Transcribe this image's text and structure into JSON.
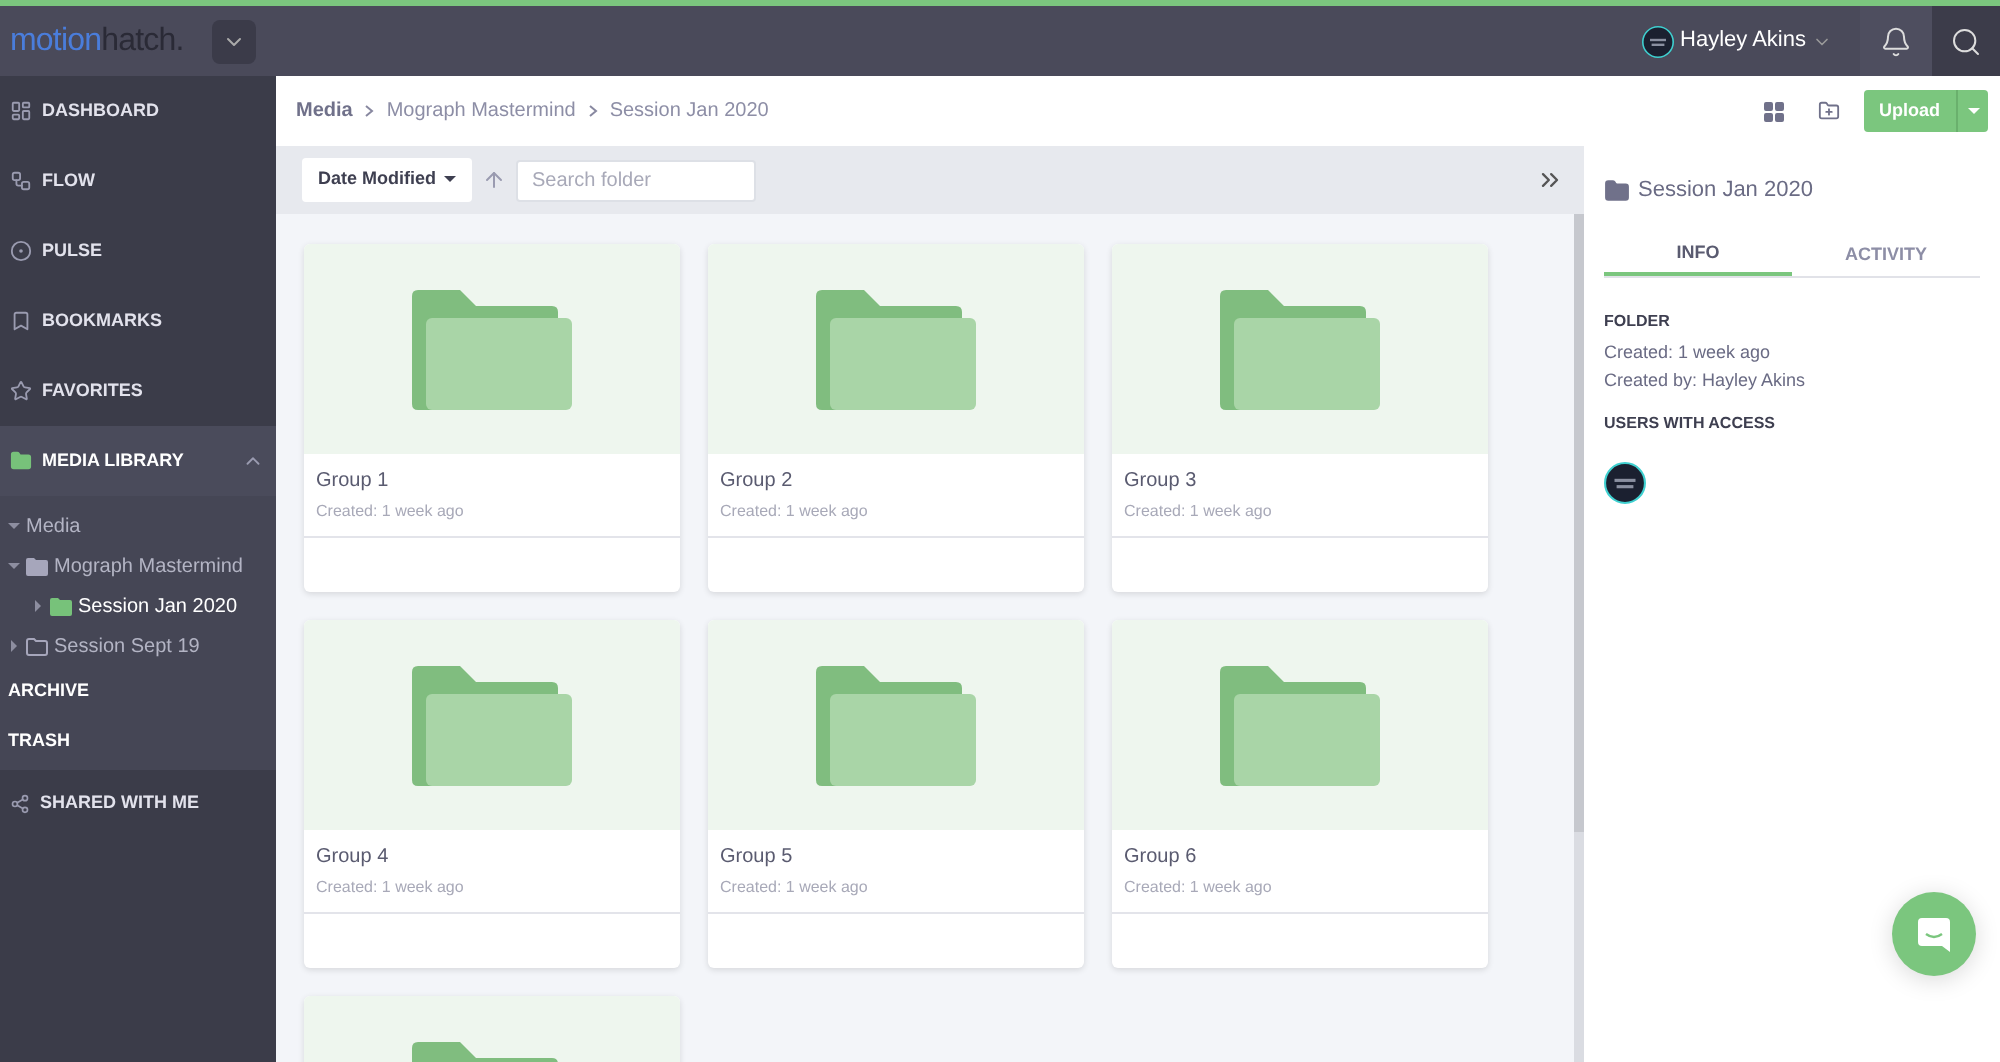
{
  "brand": {
    "part1": "motion",
    "part2": "hatch."
  },
  "user": {
    "name": "Hayley Akins"
  },
  "nav": [
    {
      "label": "DASHBOARD",
      "selected": false
    },
    {
      "label": "FLOW",
      "selected": false
    },
    {
      "label": "PULSE",
      "selected": false
    },
    {
      "label": "BOOKMARKS",
      "selected": false
    },
    {
      "label": "FAVORITES",
      "selected": false
    }
  ],
  "media_library": {
    "label": "MEDIA LIBRARY",
    "expanded": true,
    "selected": true,
    "tree": [
      {
        "label": "Media",
        "expanded": true,
        "selected": false,
        "children": [
          {
            "label": "Mograph Mastermind",
            "expanded": true,
            "selected": false,
            "children": [
              {
                "label": "Session Jan 2020",
                "expanded": false,
                "selected": true
              }
            ]
          },
          {
            "label": "Session Sept 19",
            "expanded": false,
            "selected": false
          }
        ]
      }
    ]
  },
  "nav_bottom": [
    {
      "label": "ARCHIVE"
    },
    {
      "label": "TRASH"
    }
  ],
  "shared": {
    "label": "SHARED WITH ME"
  },
  "breadcrumbs": [
    "Media",
    "Mograph Mastermind",
    "Session Jan 2020"
  ],
  "upload": {
    "label": "Upload"
  },
  "toolbar": {
    "sort": "Date Modified",
    "search": {
      "placeholder": "Search folder"
    }
  },
  "cards": [
    {
      "kind": "folder",
      "title": "Group 1",
      "meta": "Created: 1 week ago"
    },
    {
      "kind": "folder",
      "title": "Group 2",
      "meta": "Created: 1 week ago"
    },
    {
      "kind": "folder",
      "title": "Group 3",
      "meta": "Created: 1 week ago"
    },
    {
      "kind": "folder",
      "title": "Group 4",
      "meta": "Created: 1 week ago"
    },
    {
      "kind": "folder",
      "title": "Group 5",
      "meta": "Created: 1 week ago"
    },
    {
      "kind": "folder",
      "title": "Group 6",
      "meta": "Created: 1 week ago"
    },
    {
      "kind": "folder"
    }
  ],
  "info_panel": {
    "title": "Session Jan 2020",
    "tabs": [
      {
        "label": "INFO",
        "selected": true
      },
      {
        "label": "ACTIVITY",
        "selected": false
      }
    ],
    "folder_heading": "FOLDER",
    "created": "Created: 1 week ago",
    "created_by": "Created by: Hayley Akins",
    "access_heading": "USERS WITH ACCESS"
  }
}
